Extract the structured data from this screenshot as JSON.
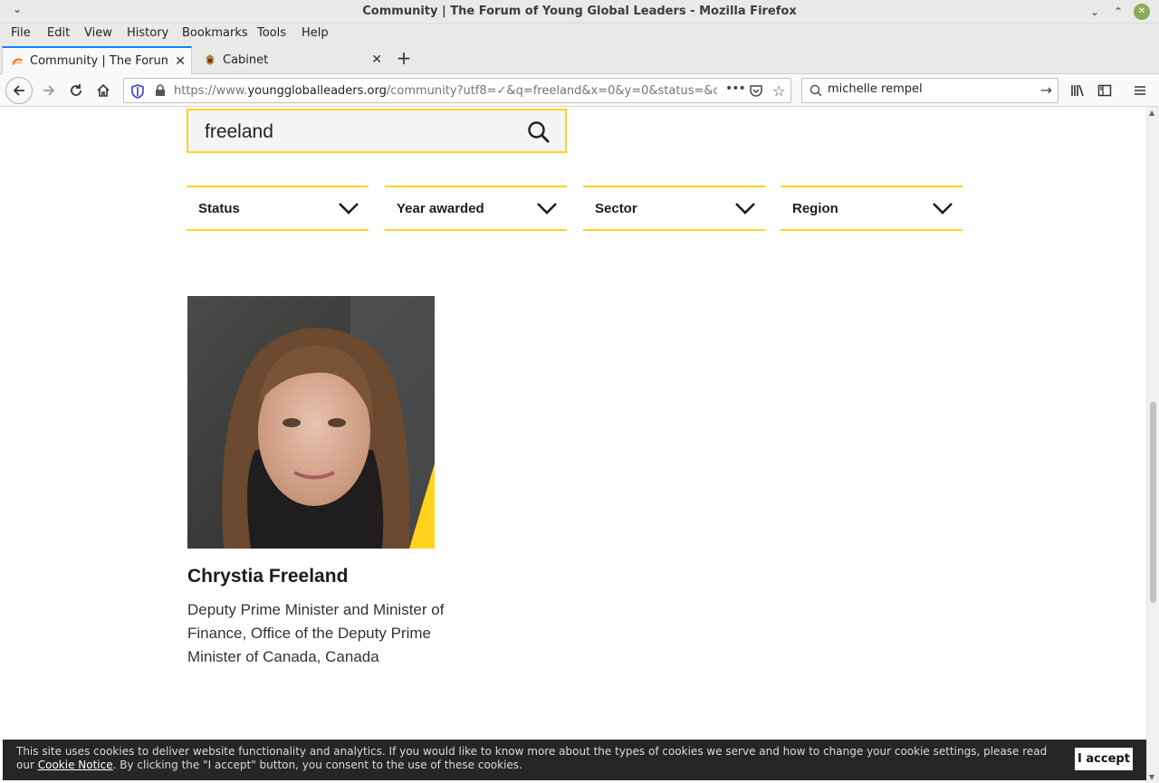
{
  "window": {
    "title": "Community | The Forum of Young Global Leaders - Mozilla Firefox"
  },
  "menu": [
    "File",
    "Edit",
    "View",
    "History",
    "Bookmarks",
    "Tools",
    "Help"
  ],
  "tabs": [
    {
      "label": "Community | The Forum of",
      "active": true
    },
    {
      "label": "Cabinet",
      "active": false
    }
  ],
  "nav": {
    "url_prefix": "https://www.",
    "url_host": "younggloballeaders.org",
    "url_path": "/community?utf8=✓&q=freeland&x=0&y=0&status=&class_yea",
    "search_value": "michelle rempel"
  },
  "site": {
    "search_query": "freeland",
    "filters": [
      "Status",
      "Year awarded",
      "Sector",
      "Region"
    ],
    "result": {
      "name": "Chrystia Freeland",
      "role": "Deputy Prime Minister and Minister of Finance, Office of the Deputy Prime Minister of Canada, Canada"
    }
  },
  "cookie": {
    "text_before": "This site uses cookies to deliver website functionality and analytics. If you would like to know more about the types of cookies we serve and how to change your cookie settings, please read our",
    "link": "Cookie Notice",
    "text_after": ". By clicking the \"I accept\" button, you consent to the use of these cookies.",
    "accept": "I accept"
  },
  "colors": {
    "accent_yellow": "#ffd21e",
    "firefox_blue": "#0a84ff",
    "banner_bg": "#262626"
  }
}
